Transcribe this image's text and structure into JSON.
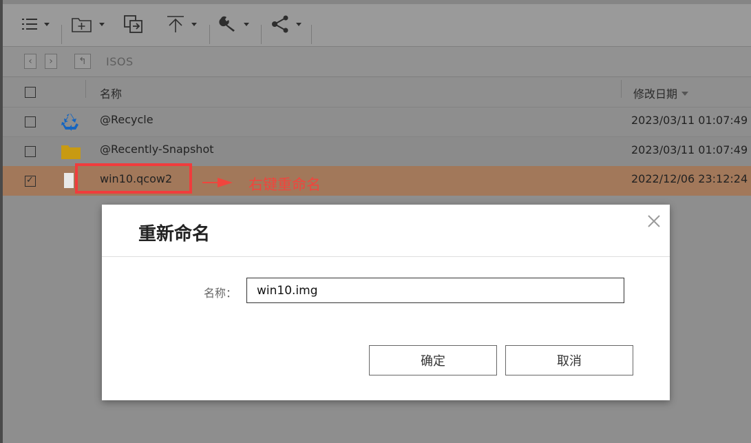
{
  "nav": {
    "path": "ISOS"
  },
  "header": {
    "name": "名称",
    "date": "修改日期"
  },
  "rows": [
    {
      "name": "@Recycle",
      "date": "2023/03/11 01:07:49",
      "icon": "recycle-icon",
      "checked": false
    },
    {
      "name": "@Recently-Snapshot",
      "date": "2023/03/11 01:07:49",
      "icon": "folder-icon",
      "checked": false
    },
    {
      "name": "win10.qcow2",
      "date": "2022/12/06 23:12:24",
      "icon": "file-icon",
      "checked": true
    }
  ],
  "annotation": {
    "text": "右键重命名",
    "color": "#f0453d"
  },
  "dialog": {
    "title": "重新命名",
    "field_label": "名称：",
    "field_value": "win10.img",
    "ok_label": "确定",
    "cancel_label": "取消"
  },
  "colors": {
    "selected_row": "#a2785a",
    "annotation": "#f0453d"
  }
}
